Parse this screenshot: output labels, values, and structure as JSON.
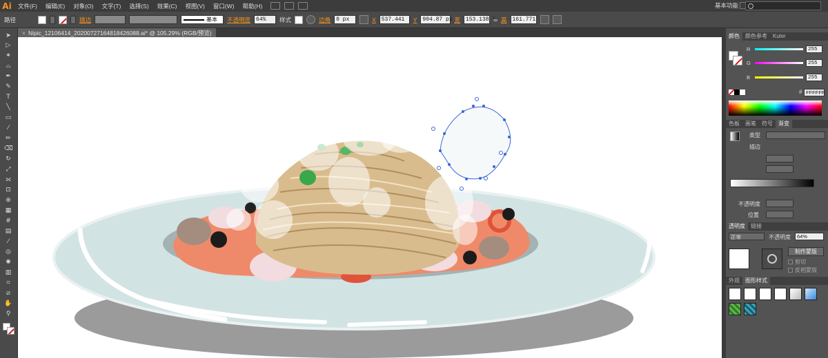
{
  "app": {
    "logo": "Ai"
  },
  "menu": [
    "文件(F)",
    "编辑(E)",
    "对象(O)",
    "文字(T)",
    "选择(S)",
    "效果(C)",
    "视图(V)",
    "窗口(W)",
    "帮助(H)"
  ],
  "workspace": "基本功能",
  "control": {
    "mode": "路径",
    "stroke_label": "描边",
    "stroke_style": "基本",
    "opacity_label": "不透明度",
    "opacity_value": "64%",
    "style_label": "样式",
    "corner_label": "边角",
    "corner_value": "0 px",
    "x_label": "X",
    "x_value": "537.441 |",
    "y_label": "Y",
    "y_value": "904.87 px",
    "w_label": "宽",
    "w_value": "153.138 |",
    "h_label": "高",
    "h_value": "161.771 |"
  },
  "document": {
    "tab": "Nipic_12106414_20200727164818426088.ai* @ 105.29% (RGB/预览)",
    "close": "×"
  },
  "panels": {
    "color": {
      "tabs": [
        "颜色",
        "颜色参考",
        "Kuler"
      ],
      "channels": [
        {
          "ch": "R",
          "value": "255",
          "color": "#ff0000"
        },
        {
          "ch": "G",
          "value": "255",
          "color": "#00ff00"
        },
        {
          "ch": "B",
          "value": "255",
          "color": "#0000ff"
        }
      ],
      "hex": "FFFFFF"
    },
    "gradient": {
      "tabs": [
        "色板",
        "画笔",
        "符号",
        "渐变"
      ],
      "type_label": "类型",
      "stroke_label": "描边",
      "opacity_label": "不透明度",
      "position_label": "位置"
    },
    "transparency": {
      "tabs": [
        "透明度",
        "链接"
      ],
      "blend": "正常",
      "opacity_label": "不透明度",
      "opacity_value": "64%",
      "make_mask": "制作蒙版",
      "clip": "剪切",
      "invert": "反相蒙版"
    },
    "appearance": {
      "tabs": [
        "外观",
        "图形样式"
      ]
    }
  },
  "colors": {
    "accent": "#f7941d",
    "selection": "#3a66d9",
    "plate": "#d2e3e4",
    "sauce": "#ee8a6a",
    "pasta": "#d9bc8e"
  }
}
